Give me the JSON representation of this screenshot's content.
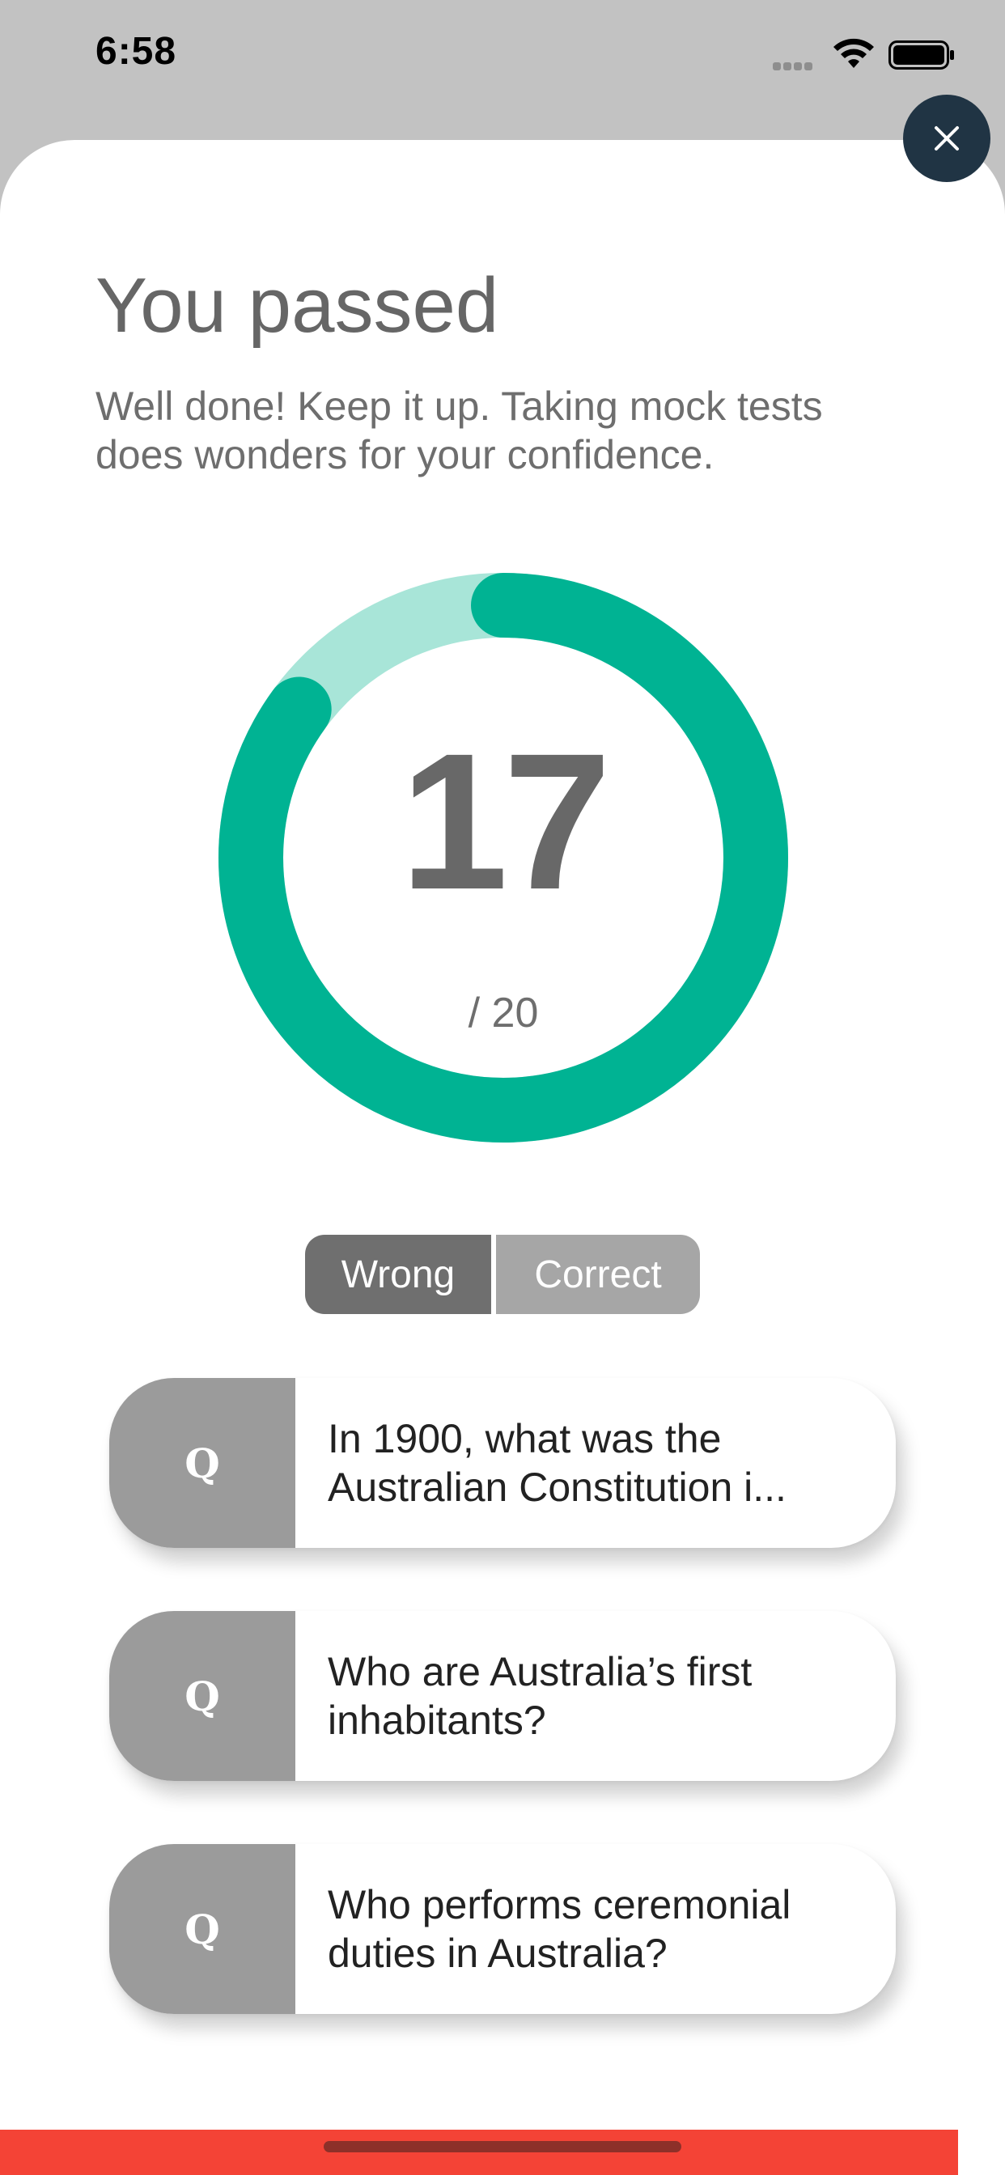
{
  "status_bar": {
    "time": "6:58"
  },
  "result": {
    "title": "You passed",
    "message": "Well done! Keep it up. Taking mock tests does wonders for your confidence.",
    "score": "17",
    "total_label": "/ 20",
    "score_fraction": 0.85,
    "colors": {
      "progress": "#00b393",
      "track": "#a8e5d8",
      "text": "#686868"
    }
  },
  "close_button": {
    "icon": "close-icon",
    "color": "#203444"
  },
  "filter": {
    "wrong_label": "Wrong",
    "correct_label": "Correct",
    "selected": "Wrong"
  },
  "questions": [
    {
      "badge": "Q",
      "text": "In 1900, what was the Australian Constitution i..."
    },
    {
      "badge": "Q",
      "text": "Who are Australia’s first inhabitants?"
    },
    {
      "badge": "Q",
      "text": "Who performs ceremonial duties in Australia?"
    }
  ],
  "bottom_bar": {
    "color": "#f44336"
  }
}
